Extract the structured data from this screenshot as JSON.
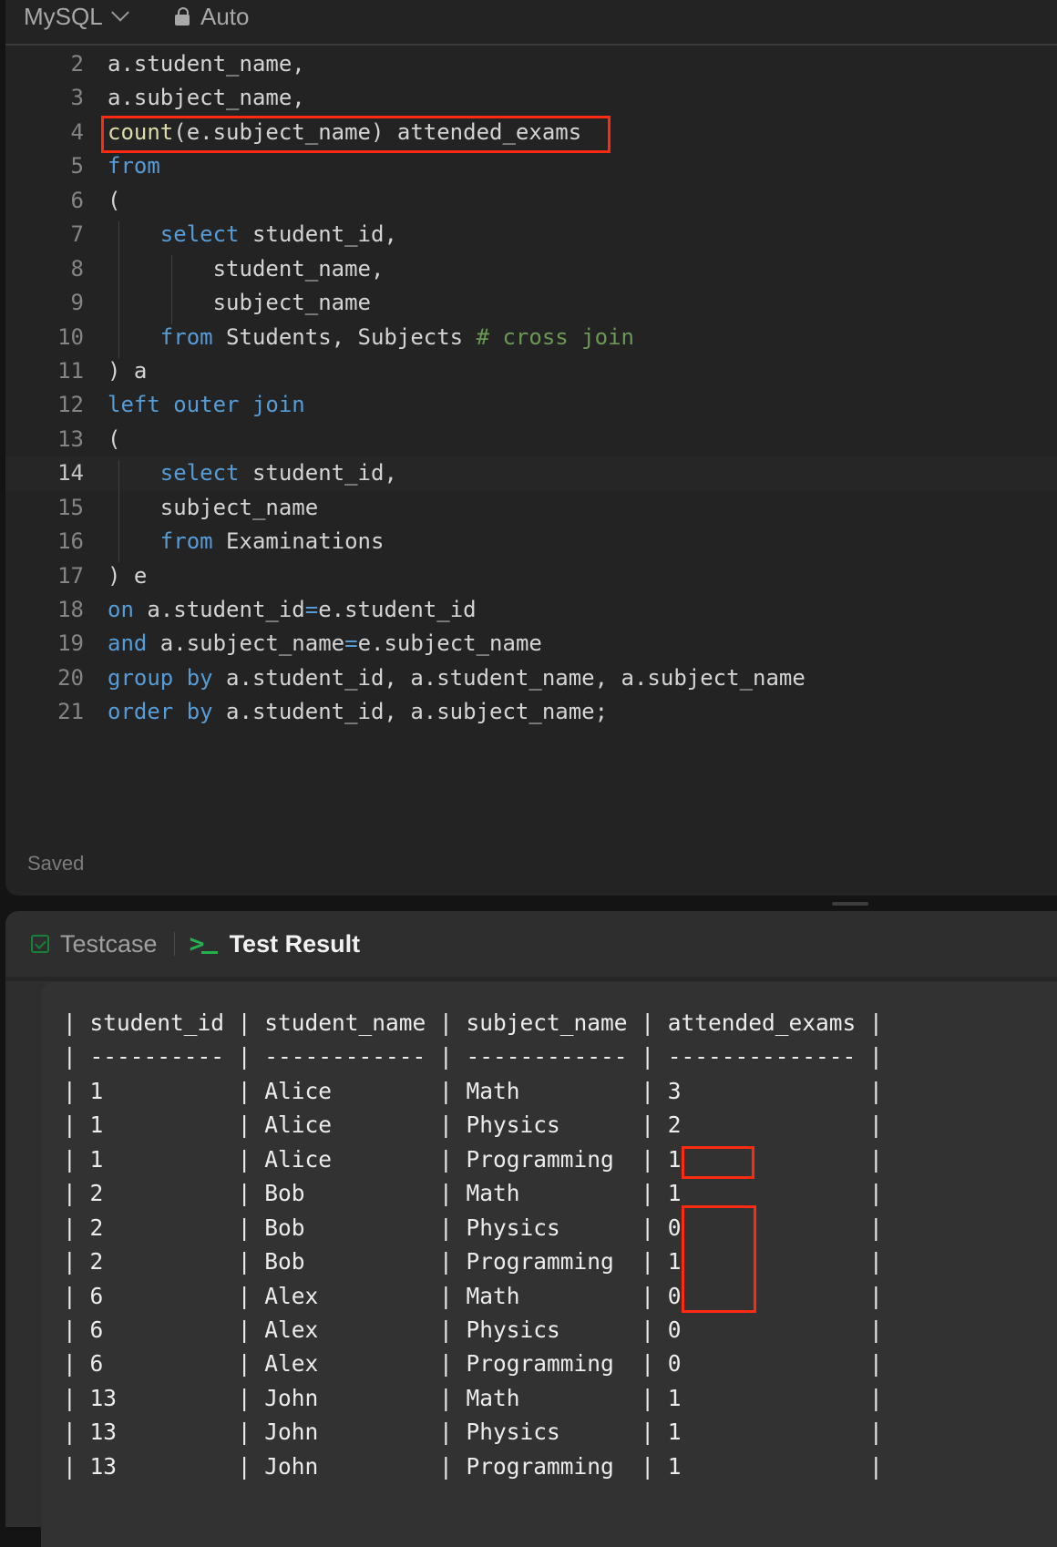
{
  "editor": {
    "language": "MySQL",
    "mode": "Auto",
    "status": "Saved",
    "active_line": 14,
    "lines": [
      {
        "n": "2",
        "tokens": [
          {
            "t": "a.student_name,",
            "c": "plain"
          }
        ]
      },
      {
        "n": "3",
        "tokens": [
          {
            "t": "a.subject_name,",
            "c": "plain"
          }
        ]
      },
      {
        "n": "4",
        "tokens": [
          {
            "t": "count",
            "c": "fn"
          },
          {
            "t": "(e.subject_name) attended_exams",
            "c": "plain"
          }
        ]
      },
      {
        "n": "5",
        "tokens": [
          {
            "t": "from",
            "c": "kw"
          }
        ]
      },
      {
        "n": "6",
        "tokens": [
          {
            "t": "(",
            "c": "plain"
          }
        ]
      },
      {
        "n": "7",
        "tokens": [
          {
            "t": "    ",
            "c": "plain"
          },
          {
            "t": "select",
            "c": "kw"
          },
          {
            "t": " student_id,",
            "c": "plain"
          }
        ]
      },
      {
        "n": "8",
        "tokens": [
          {
            "t": "        student_name,",
            "c": "plain"
          }
        ]
      },
      {
        "n": "9",
        "tokens": [
          {
            "t": "        subject_name",
            "c": "plain"
          }
        ]
      },
      {
        "n": "10",
        "tokens": [
          {
            "t": "    ",
            "c": "plain"
          },
          {
            "t": "from",
            "c": "kw"
          },
          {
            "t": " Students, Subjects ",
            "c": "plain"
          },
          {
            "t": "# cross join",
            "c": "cm"
          }
        ]
      },
      {
        "n": "11",
        "tokens": [
          {
            "t": ") a",
            "c": "plain"
          }
        ]
      },
      {
        "n": "12",
        "tokens": [
          {
            "t": "left outer join",
            "c": "kw"
          }
        ]
      },
      {
        "n": "13",
        "tokens": [
          {
            "t": "(",
            "c": "plain"
          }
        ]
      },
      {
        "n": "14",
        "tokens": [
          {
            "t": "    ",
            "c": "plain"
          },
          {
            "t": "select",
            "c": "kw"
          },
          {
            "t": " student_id,",
            "c": "plain"
          }
        ]
      },
      {
        "n": "15",
        "tokens": [
          {
            "t": "    subject_name",
            "c": "plain"
          }
        ]
      },
      {
        "n": "16",
        "tokens": [
          {
            "t": "    ",
            "c": "plain"
          },
          {
            "t": "from",
            "c": "kw"
          },
          {
            "t": " Examinations",
            "c": "plain"
          }
        ]
      },
      {
        "n": "17",
        "tokens": [
          {
            "t": ") e",
            "c": "plain"
          }
        ]
      },
      {
        "n": "18",
        "tokens": [
          {
            "t": "on",
            "c": "kw"
          },
          {
            "t": " a.student_id",
            "c": "plain"
          },
          {
            "t": "=",
            "c": "op"
          },
          {
            "t": "e.student_id",
            "c": "plain"
          }
        ]
      },
      {
        "n": "19",
        "tokens": [
          {
            "t": "and",
            "c": "kw"
          },
          {
            "t": " a.subject_name",
            "c": "plain"
          },
          {
            "t": "=",
            "c": "op"
          },
          {
            "t": "e.subject_name",
            "c": "plain"
          }
        ]
      },
      {
        "n": "20",
        "tokens": [
          {
            "t": "group by",
            "c": "kw"
          },
          {
            "t": " a.student_id, a.student_name, a.subject_name",
            "c": "plain"
          }
        ]
      },
      {
        "n": "21",
        "tokens": [
          {
            "t": "order by",
            "c": "kw"
          },
          {
            "t": " a.student_id, a.subject_name;",
            "c": "plain"
          }
        ]
      }
    ]
  },
  "bottom": {
    "tabs": [
      {
        "label": "Testcase",
        "icon": "checkbox-icon",
        "active": false
      },
      {
        "label": "Test Result",
        "icon": "terminal-icon",
        "active": true
      }
    ],
    "result_table": {
      "columns": [
        "student_id",
        "student_name",
        "subject_name",
        "attended_exams"
      ],
      "rows": [
        [
          "1",
          "Alice",
          "Math",
          "3"
        ],
        [
          "1",
          "Alice",
          "Physics",
          "2"
        ],
        [
          "1",
          "Alice",
          "Programming",
          "1"
        ],
        [
          "2",
          "Bob",
          "Math",
          "1"
        ],
        [
          "2",
          "Bob",
          "Physics",
          "0"
        ],
        [
          "2",
          "Bob",
          "Programming",
          "1"
        ],
        [
          "6",
          "Alex",
          "Math",
          "0"
        ],
        [
          "6",
          "Alex",
          "Physics",
          "0"
        ],
        [
          "6",
          "Alex",
          "Programming",
          "0"
        ],
        [
          "13",
          "John",
          "Math",
          "1"
        ],
        [
          "13",
          "John",
          "Physics",
          "1"
        ],
        [
          "13",
          "John",
          "Programming",
          "1"
        ]
      ]
    }
  },
  "annotations": {
    "color": "#ff2a12",
    "boxes": [
      "editor line 4: count(e.subject_name) attended_exams",
      "result row 5 attended_exams: 0",
      "result rows 7-9 attended_exams: 0"
    ]
  }
}
